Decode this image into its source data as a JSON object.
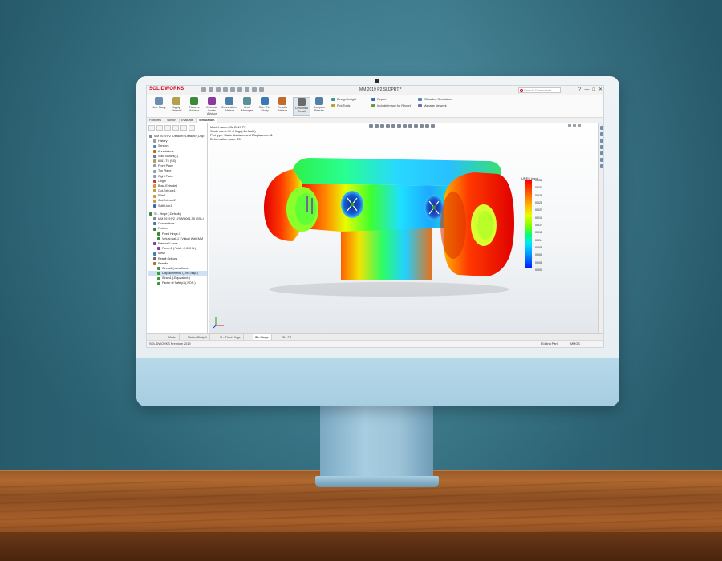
{
  "app": {
    "logo_text": "SOLIDWORKS",
    "document_title": "MM 2019 P2.SLDPRT *",
    "search_placeholder": "Search Commands",
    "window_controls": [
      "?",
      "—",
      "□",
      "✕"
    ]
  },
  "ribbon": {
    "buttons": [
      {
        "id": "new-study",
        "label": "New Study",
        "color": "#6a8db0"
      },
      {
        "id": "apply-material",
        "label": "Apply Material",
        "color": "#b0a14a"
      },
      {
        "id": "fixtures",
        "label": "Fixtures Advisor",
        "color": "#3a8a3a"
      },
      {
        "id": "external-loads",
        "label": "External Loads Advisor",
        "color": "#8a3a9a"
      },
      {
        "id": "connections",
        "label": "Connections Advisor",
        "color": "#4a7fa8"
      },
      {
        "id": "shell-manager",
        "label": "Shell Manager",
        "color": "#5a8f9a"
      },
      {
        "id": "run-study",
        "label": "Run This Study",
        "color": "#3b78b5"
      },
      {
        "id": "results-advisor",
        "label": "Results Advisor",
        "color": "#c26a2a"
      },
      {
        "id": "deformed-result",
        "label": "Deformed Result",
        "color": "#6a6a6a"
      },
      {
        "id": "compare-results",
        "label": "Compare Results",
        "color": "#5580a8"
      }
    ],
    "small_items": [
      {
        "id": "design-insight",
        "label": "Design Insight",
        "color": "#3a9a8a"
      },
      {
        "id": "plot-tools",
        "label": "Plot Tools",
        "color": "#c2a02a"
      },
      {
        "id": "report",
        "label": "Report",
        "color": "#3a6ab5"
      },
      {
        "id": "include-image",
        "label": "Include Image for Report",
        "color": "#6a9a3a"
      },
      {
        "id": "offloaded-sim",
        "label": "Offloaded Simulation",
        "color": "#4a8ab5"
      },
      {
        "id": "manage-network",
        "label": "Manage Network",
        "color": "#7a6ab5"
      }
    ]
  },
  "command_tabs": [
    "Features",
    "Sketch",
    "Evaluate",
    "SimulationXpress"
  ],
  "active_command_tab": "Simulation",
  "feature_tree": {
    "items": [
      {
        "label": "MM 2019 P2  (Default<<Default>_Disp",
        "indent": 0,
        "icon": "part-icon",
        "color": "#7a8a9a"
      },
      {
        "label": "History",
        "indent": 1,
        "icon": "history-icon",
        "color": "#9a9a9a"
      },
      {
        "label": "Sensors",
        "indent": 1,
        "icon": "sensor-icon",
        "color": "#4a8ab5"
      },
      {
        "label": "Annotations",
        "indent": 1,
        "icon": "annotation-icon",
        "color": "#c26a2a"
      },
      {
        "label": "Solid Bodies(1)",
        "indent": 1,
        "icon": "solid-body-icon",
        "color": "#6a7a8a"
      },
      {
        "label": "6061-T6 (SS)",
        "indent": 1,
        "icon": "material-icon",
        "color": "#b0a14a"
      },
      {
        "label": "Front Plane",
        "indent": 1,
        "icon": "plane-icon",
        "color": "#8aa0b5"
      },
      {
        "label": "Top Plane",
        "indent": 1,
        "icon": "plane-icon",
        "color": "#8aa0b5"
      },
      {
        "label": "Right Plane",
        "indent": 1,
        "icon": "plane-icon",
        "color": "#8aa0b5"
      },
      {
        "label": "Origin",
        "indent": 1,
        "icon": "origin-icon",
        "color": "#c23a3a"
      },
      {
        "label": "Boss-Extrude1",
        "indent": 1,
        "icon": "feature-icon",
        "color": "#d09a3a"
      },
      {
        "label": "Cut-Extrude1",
        "indent": 1,
        "icon": "feature-icon",
        "color": "#d09a3a"
      },
      {
        "label": "Fillet1",
        "indent": 1,
        "icon": "feature-icon",
        "color": "#d09a3a"
      },
      {
        "label": "Cut-Extrude2",
        "indent": 1,
        "icon": "feature-icon",
        "color": "#d09a3a"
      },
      {
        "label": "Split Line1",
        "indent": 1,
        "icon": "split-line-icon",
        "color": "#3a6ab5"
      },
      {
        "label": "",
        "gap": true
      },
      {
        "label": "SI - Hinge  (-Default-)",
        "indent": 0,
        "icon": "study-icon",
        "color": "#3a8a3a"
      },
      {
        "label": "MM 2019 P2 (-[SW]6061-T6 (SS)-)",
        "indent": 1,
        "icon": "part-icon",
        "color": "#7a8a9a"
      },
      {
        "label": "Connections",
        "indent": 1,
        "icon": "connections-icon",
        "color": "#4a7fa8"
      },
      {
        "label": "Fixtures",
        "indent": 1,
        "icon": "fixtures-icon",
        "color": "#3a8a3a"
      },
      {
        "label": "Fixed Hinge-1",
        "indent": 2,
        "icon": "fixed-hinge-icon",
        "color": "#3a8a3a"
      },
      {
        "label": "Virtual wall-1 (:Virtual Wall<MM",
        "indent": 2,
        "icon": "virtual-wall-icon",
        "color": "#3a8a3a"
      },
      {
        "label": "External Loads",
        "indent": 1,
        "icon": "loads-icon",
        "color": "#8a3a9a"
      },
      {
        "label": "Force-1 (:Total: -1,000 N:)",
        "indent": 2,
        "icon": "force-icon",
        "color": "#8a3a9a"
      },
      {
        "label": "Mesh",
        "indent": 1,
        "icon": "mesh-icon",
        "color": "#4a7fa8"
      },
      {
        "label": "Result Options",
        "indent": 1,
        "icon": "result-options-icon",
        "color": "#6a6a6a"
      },
      {
        "label": "Results",
        "indent": 1,
        "icon": "results-icon",
        "color": "#c26a2a"
      },
      {
        "label": "Stress1 (-vonMises-)",
        "indent": 2,
        "icon": "plot-icon",
        "color": "#3a9a3a"
      },
      {
        "label": "Displacement1 (-Res disp-)",
        "indent": 2,
        "icon": "plot-icon",
        "color": "#3a9a3a",
        "selected": true
      },
      {
        "label": "Strain1 (-Equivalent-)",
        "indent": 2,
        "icon": "plot-icon",
        "color": "#3a9a3a"
      },
      {
        "label": "Factor of Safety1 (-FOS-)",
        "indent": 2,
        "icon": "plot-icon",
        "color": "#3a9a3a"
      }
    ]
  },
  "study_info": {
    "model_name": "Model name:MM 2019 P2",
    "study_name": "Study name:SI - Hinge(-Default-)",
    "plot_type": "Plot type: Static displacement Displacement1",
    "deformation": "Deformation scale: 20"
  },
  "legend": {
    "title": "URES (mm)",
    "ticks": [
      "0.033",
      "0.031",
      "0.028",
      "0.025",
      "0.022",
      "0.019",
      "0.017",
      "0.014",
      "0.011",
      "0.008",
      "0.006",
      "0.003",
      "0.000"
    ]
  },
  "bottom_tabs": [
    {
      "label": "Model",
      "active": false
    },
    {
      "label": "Motion Study 1",
      "active": false
    },
    {
      "label": "SI - Fixed Hinge",
      "active": false
    },
    {
      "label": "SI - Hinge",
      "active": true
    },
    {
      "label": "SI - FS",
      "active": false
    }
  ],
  "status": {
    "product": "SOLIDWORKS Premium 2019",
    "mode": "Editing Part",
    "units": "MMGS"
  }
}
